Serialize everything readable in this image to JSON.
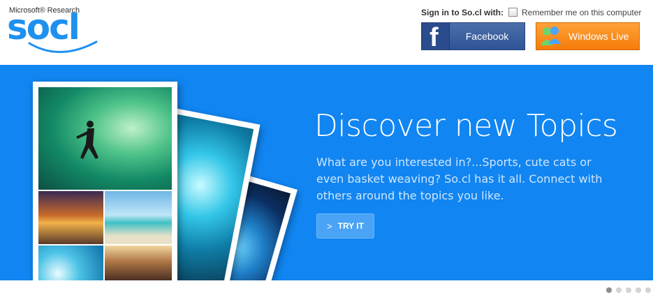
{
  "brand": {
    "super_label": "Microsoft® Research",
    "logo_text": "socl",
    "logo_color": "#1e90ef"
  },
  "signin": {
    "label": "Sign in to So.cl with:",
    "remember_label": "Remember me on this computer",
    "remember_checked": false,
    "facebook": {
      "label": "Facebook",
      "icon": "facebook-f-icon",
      "color": "#3b5998"
    },
    "windows_live": {
      "label": "Windows Live",
      "icon": "windows-live-messenger-icon",
      "color": "#f7891b"
    }
  },
  "hero": {
    "background": "#1185f1",
    "title": "Discover new Topics",
    "body": "What are you interested in?...Sports, cute cats or even basket weaving?  So.cl has it all. Connect with others around the topics you like.",
    "cta": {
      "label": "TRY IT",
      "icon": "chevron-right-icon"
    },
    "photos": [
      "surfing-collage-photo",
      "underwater-photo",
      "concert-photo"
    ]
  },
  "pager": {
    "count": 5,
    "active_index": 0
  }
}
